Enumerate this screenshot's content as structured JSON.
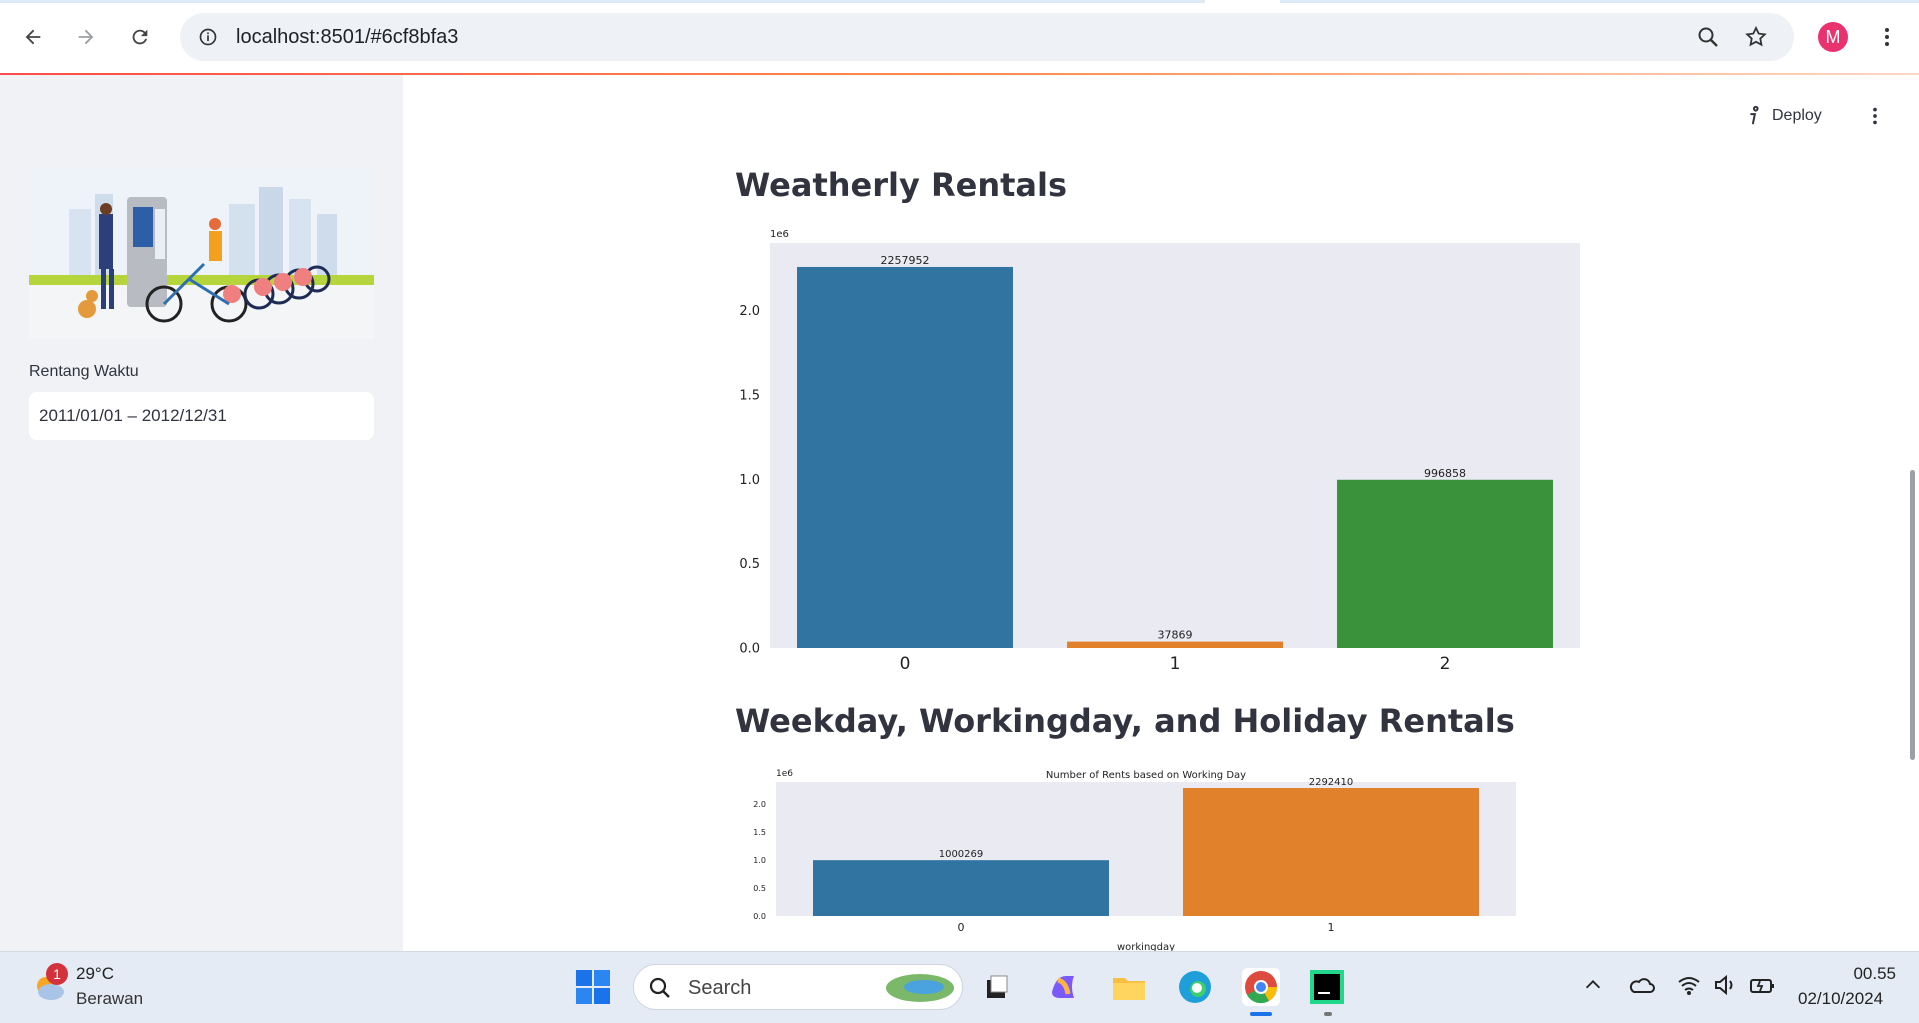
{
  "browser": {
    "url": "localhost:8501/#6cf8bfa3",
    "profile_initial": "M"
  },
  "sidebar": {
    "date_label": "Rentang Waktu",
    "date_value": "2011/01/01 – 2012/12/31"
  },
  "header": {
    "deploy_label": "Deploy"
  },
  "main": {
    "section1_title": "Weatherly Rentals",
    "section2_title": "Weekday, Workingday, and Holiday Rentals"
  },
  "chart_data": [
    {
      "type": "bar",
      "title": "",
      "xlabel": "",
      "ylabel": "",
      "scale_label": "1e6",
      "categories": [
        "0",
        "1",
        "2"
      ],
      "values": [
        2257952,
        37869,
        996858
      ],
      "colors": [
        "#3274a1",
        "#e1812c",
        "#3a923a"
      ],
      "ylim": [
        0,
        2400000
      ],
      "yticks": [
        0.0,
        0.5,
        1.0,
        1.5,
        2.0
      ],
      "background": "#eaeaf2",
      "grid": false
    },
    {
      "type": "bar",
      "title": "Number of Rents based on Working Day",
      "xlabel": "workingday",
      "ylabel": "",
      "scale_label": "1e6",
      "categories": [
        "0",
        "1"
      ],
      "values": [
        1000269,
        2292410
      ],
      "colors": [
        "#3274a1",
        "#e1812c"
      ],
      "ylim": [
        0,
        2400000
      ],
      "yticks": [
        0.0,
        0.5,
        1.0,
        1.5,
        2.0
      ],
      "background": "#eaeaf2",
      "grid": false
    }
  ],
  "taskbar": {
    "weather_temp": "29°C",
    "weather_desc": "Berawan",
    "weather_badge": "1",
    "search_placeholder": "Search",
    "time": "00.55",
    "date": "02/10/2024"
  }
}
